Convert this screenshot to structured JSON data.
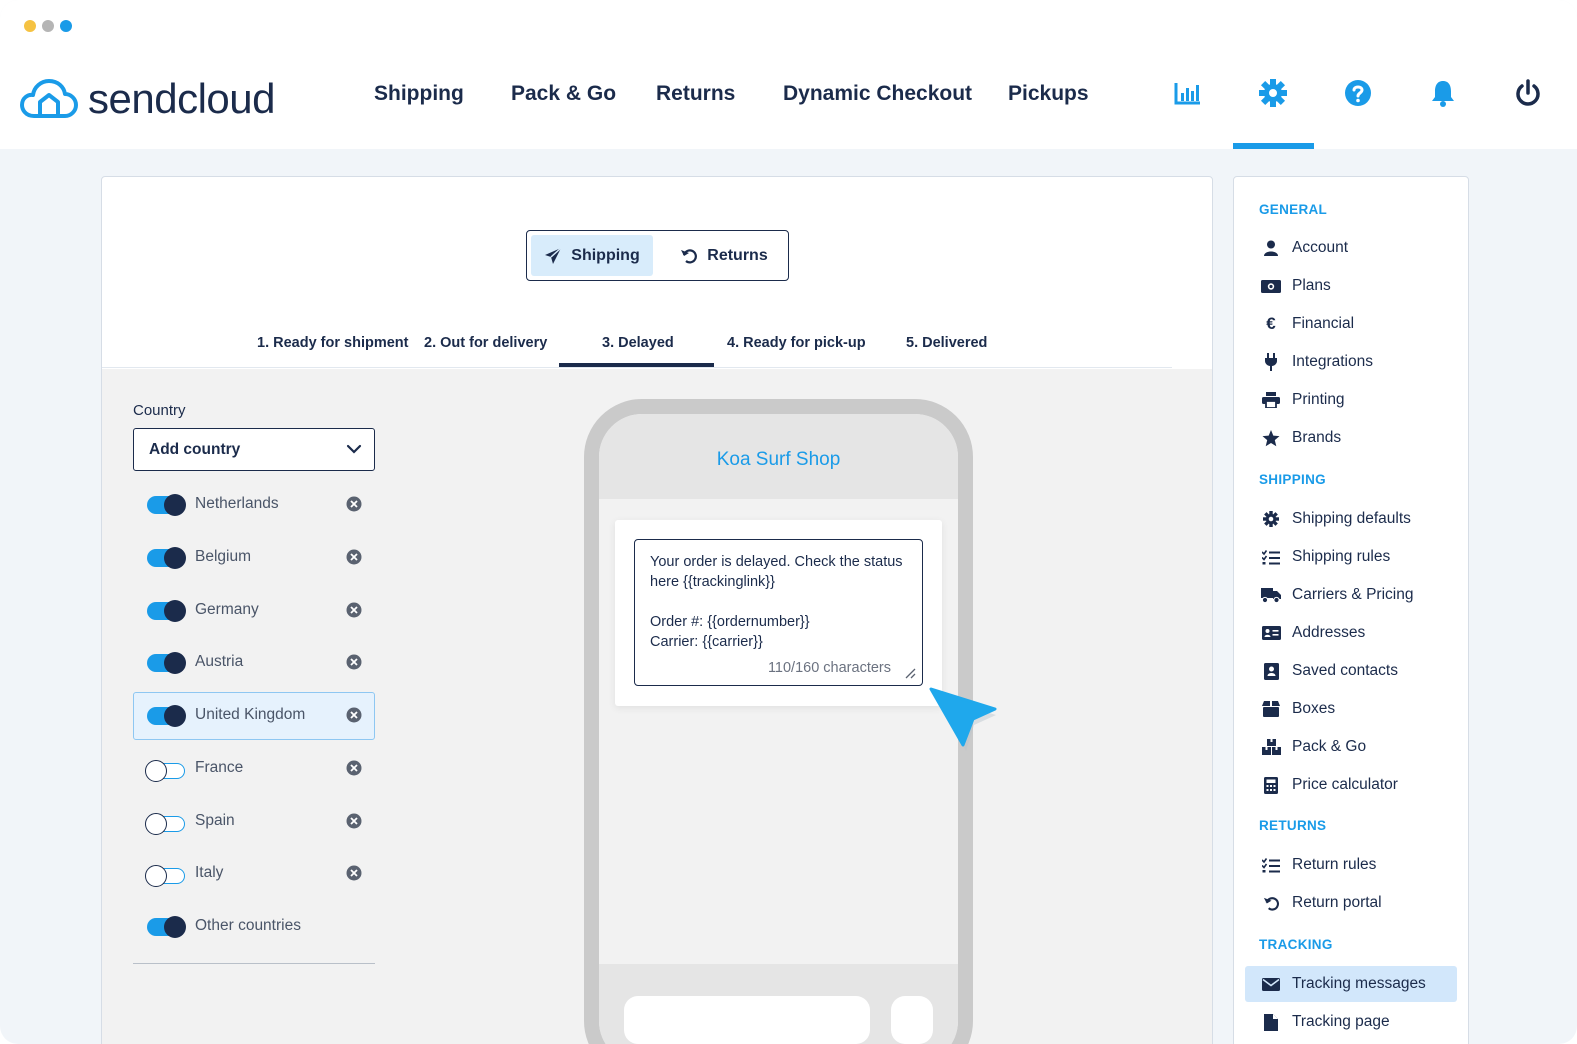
{
  "window": {
    "dots": [
      "#f5c242",
      "#b5b5b5",
      "#1a9be8"
    ]
  },
  "brand": {
    "name": "sendcloud"
  },
  "topnav": {
    "items": [
      "Shipping",
      "Pack & Go",
      "Returns",
      "Dynamic Checkout",
      "Pickups"
    ],
    "icons": [
      "analytics-icon",
      "settings-icon",
      "help-icon",
      "notifications-icon",
      "power-icon"
    ],
    "active_icon": "settings-icon"
  },
  "segmented": {
    "shipping": "Shipping",
    "returns": "Returns",
    "active": "Shipping"
  },
  "steps": [
    "1.  Ready for shipment",
    "2. Out for delivery",
    "3. Delayed",
    "4. Ready for pick-up",
    "5. Delivered"
  ],
  "active_step": "3. Delayed",
  "country": {
    "label": "Country",
    "select_value": "Add country",
    "rows": [
      {
        "name": "Netherlands",
        "enabled": true,
        "removable": true
      },
      {
        "name": "Belgium",
        "enabled": true,
        "removable": true
      },
      {
        "name": "Germany",
        "enabled": true,
        "removable": true
      },
      {
        "name": "Austria",
        "enabled": true,
        "removable": true
      },
      {
        "name": "United Kingdom",
        "enabled": true,
        "removable": true,
        "selected": true
      },
      {
        "name": "France",
        "enabled": false,
        "removable": true
      },
      {
        "name": "Spain",
        "enabled": false,
        "removable": true
      },
      {
        "name": "Italy",
        "enabled": false,
        "removable": true
      },
      {
        "name": "Other countries",
        "enabled": true,
        "removable": false
      }
    ]
  },
  "preview": {
    "shop_name": "Koa Surf Shop",
    "message": "Your order is delayed. Check the status here {{trackinglink}}\n\nOrder #: {{ordernumber}}\nCarrier: {{carrier}}",
    "char_count": "110/160 characters"
  },
  "sidebar": {
    "sections": [
      {
        "title": "GENERAL",
        "items": [
          {
            "label": "Account",
            "icon": "user-icon"
          },
          {
            "label": "Plans",
            "icon": "money-icon"
          },
          {
            "label": "Financial",
            "icon": "euro-icon"
          },
          {
            "label": "Integrations",
            "icon": "plug-icon"
          },
          {
            "label": "Printing",
            "icon": "printer-icon"
          },
          {
            "label": "Brands",
            "icon": "star-icon"
          }
        ]
      },
      {
        "title": "SHIPPING",
        "items": [
          {
            "label": "Shipping defaults",
            "icon": "gear-icon"
          },
          {
            "label": "Shipping rules",
            "icon": "checklist-icon"
          },
          {
            "label": "Carriers & Pricing",
            "icon": "truck-icon"
          },
          {
            "label": "Addresses",
            "icon": "address-card-icon"
          },
          {
            "label": "Saved contacts",
            "icon": "contact-icon"
          },
          {
            "label": "Boxes",
            "icon": "box-icon"
          },
          {
            "label": "Pack & Go",
            "icon": "boxes-icon"
          },
          {
            "label": "Price calculator",
            "icon": "calculator-icon"
          }
        ]
      },
      {
        "title": "RETURNS",
        "items": [
          {
            "label": "Return rules",
            "icon": "checklist-icon"
          },
          {
            "label": "Return portal",
            "icon": "undo-icon"
          }
        ]
      },
      {
        "title": "TRACKING",
        "items": [
          {
            "label": "Tracking messages",
            "icon": "envelope-icon",
            "active": true
          },
          {
            "label": "Tracking page",
            "icon": "file-icon"
          }
        ]
      }
    ]
  },
  "colors": {
    "accent": "#1a9be8",
    "navy": "#1b2b4b",
    "active_bg": "#d2e7fb"
  }
}
